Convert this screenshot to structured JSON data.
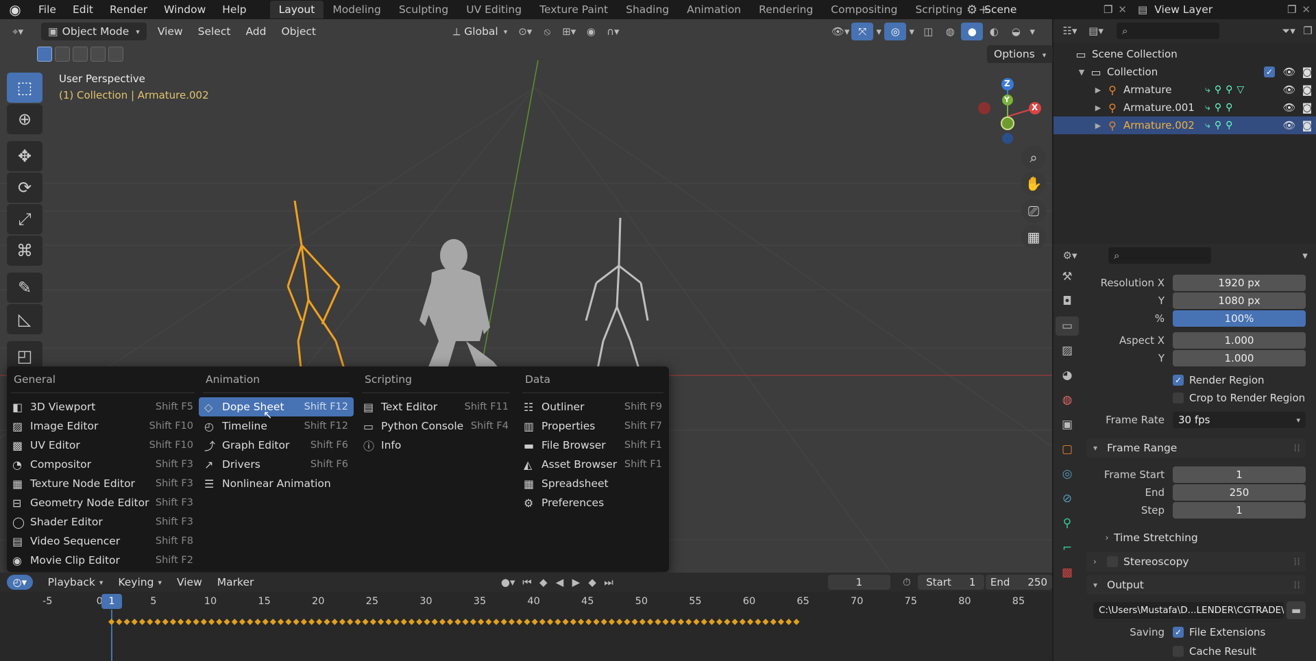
{
  "topbar": {
    "menus": [
      "File",
      "Edit",
      "Render",
      "Window",
      "Help"
    ],
    "workspaces": [
      "Layout",
      "Modeling",
      "Sculpting",
      "UV Editing",
      "Texture Paint",
      "Shading",
      "Animation",
      "Rendering",
      "Compositing",
      "Scripting"
    ],
    "active_workspace": "Layout",
    "scene": "Scene",
    "view_layer": "View Layer"
  },
  "viewport": {
    "mode": "Object Mode",
    "menus": [
      "View",
      "Select",
      "Add",
      "Object"
    ],
    "transform_orientation": "Global",
    "options_label": "Options",
    "title": "User Perspective",
    "subtitle": "(1) Collection | Armature.002",
    "gizmo": {
      "z": "Z",
      "y": "Y",
      "x": "X"
    }
  },
  "editor_menu": {
    "columns": [
      {
        "header": "General",
        "items": [
          {
            "label": "3D Viewport",
            "shortcut": "Shift F5",
            "icon": "viewport-icon"
          },
          {
            "label": "Image Editor",
            "shortcut": "Shift F10",
            "icon": "image-icon"
          },
          {
            "label": "UV Editor",
            "shortcut": "Shift F10",
            "icon": "uv-icon"
          },
          {
            "label": "Compositor",
            "shortcut": "Shift F3",
            "icon": "compositor-icon"
          },
          {
            "label": "Texture Node Editor",
            "shortcut": "Shift F3",
            "icon": "texture-icon"
          },
          {
            "label": "Geometry Node Editor",
            "shortcut": "Shift F3",
            "icon": "geometry-nodes-icon"
          },
          {
            "label": "Shader Editor",
            "shortcut": "Shift F3",
            "icon": "shader-icon"
          },
          {
            "label": "Video Sequencer",
            "shortcut": "Shift F8",
            "icon": "sequencer-icon"
          },
          {
            "label": "Movie Clip Editor",
            "shortcut": "Shift F2",
            "icon": "clip-icon"
          }
        ]
      },
      {
        "header": "Animation",
        "items": [
          {
            "label": "Dope Sheet",
            "shortcut": "Shift F12",
            "icon": "dopesheet-icon",
            "highlighted": true
          },
          {
            "label": "Timeline",
            "shortcut": "Shift F12",
            "icon": "timeline-icon"
          },
          {
            "label": "Graph Editor",
            "shortcut": "Shift F6",
            "icon": "graph-icon"
          },
          {
            "label": "Drivers",
            "shortcut": "Shift F6",
            "icon": "drivers-icon"
          },
          {
            "label": "Nonlinear Animation",
            "shortcut": "",
            "icon": "nla-icon"
          }
        ]
      },
      {
        "header": "Scripting",
        "items": [
          {
            "label": "Text Editor",
            "shortcut": "Shift F11",
            "icon": "text-icon"
          },
          {
            "label": "Python Console",
            "shortcut": "Shift F4",
            "icon": "console-icon"
          },
          {
            "label": "Info",
            "shortcut": "",
            "icon": "info-icon"
          }
        ]
      },
      {
        "header": "Data",
        "items": [
          {
            "label": "Outliner",
            "shortcut": "Shift F9",
            "icon": "outliner-icon"
          },
          {
            "label": "Properties",
            "shortcut": "Shift F7",
            "icon": "properties-icon"
          },
          {
            "label": "File Browser",
            "shortcut": "Shift F1",
            "icon": "folder-icon"
          },
          {
            "label": "Asset Browser",
            "shortcut": "Shift F1",
            "icon": "asset-icon"
          },
          {
            "label": "Spreadsheet",
            "shortcut": "",
            "icon": "spreadsheet-icon"
          },
          {
            "label": "Preferences",
            "shortcut": "",
            "icon": "gear-icon"
          }
        ]
      }
    ]
  },
  "timeline": {
    "menus": [
      "Playback",
      "Keying",
      "View",
      "Marker"
    ],
    "current_frame": "1",
    "start_label": "Start",
    "start": "1",
    "end_label": "End",
    "end": "250",
    "ruler": [
      "-5",
      "0",
      "5",
      "10",
      "15",
      "20",
      "25",
      "30",
      "35",
      "40",
      "45",
      "50",
      "55",
      "60",
      "65",
      "70",
      "75",
      "80",
      "85"
    ],
    "cursor_label": "1"
  },
  "outliner": {
    "root": "Scene Collection",
    "collection": "Collection",
    "objects": [
      "Armature",
      "Armature.001",
      "Armature.002"
    ],
    "selected": "Armature.002"
  },
  "properties": {
    "resolution_x_label": "Resolution X",
    "resolution_x": "1920 px",
    "resolution_y_label": "Y",
    "resolution_y": "1080 px",
    "percent_label": "%",
    "percent": "100%",
    "aspect_x_label": "Aspect X",
    "aspect_x": "1.000",
    "aspect_y_label": "Y",
    "aspect_y": "1.000",
    "render_region": "Render Region",
    "crop_region": "Crop to Render Region",
    "frame_rate_label": "Frame Rate",
    "frame_rate": "30 fps",
    "frame_range_title": "Frame Range",
    "frame_start_label": "Frame Start",
    "frame_start": "1",
    "end_label": "End",
    "end": "250",
    "step_label": "Step",
    "step": "1",
    "time_stretching": "Time Stretching",
    "stereoscopy": "Stereoscopy",
    "output_title": "Output",
    "output_path": "C:\\Users\\Mustafa\\D...LENDER\\CGTRADE\\",
    "saving_label": "Saving",
    "file_extensions": "File Extensions",
    "cache_result": "Cache Result"
  },
  "colors": {
    "accent": "#4772b3",
    "armature_selected": "#e8a020",
    "key": "#e0a020"
  }
}
